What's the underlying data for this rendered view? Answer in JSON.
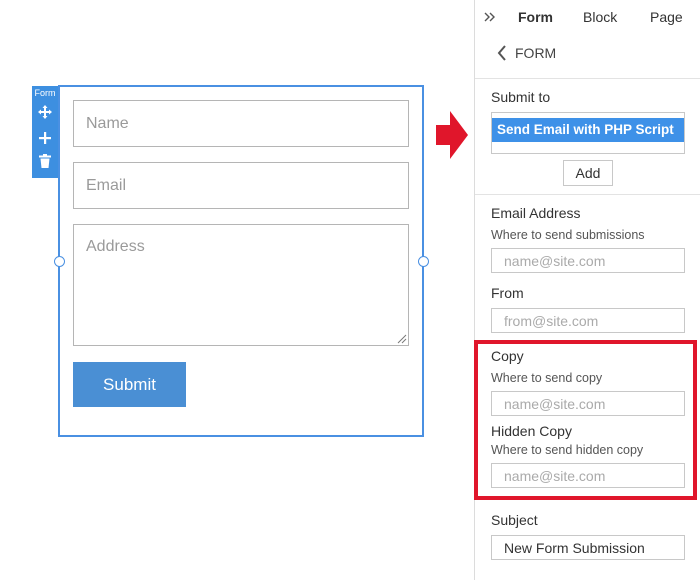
{
  "toolbar": {
    "label": "Form",
    "move_icon": "move-icon",
    "add_icon": "plus-icon",
    "delete_icon": "trash-icon"
  },
  "form": {
    "name_placeholder": "Name",
    "email_placeholder": "Email",
    "address_placeholder": "Address",
    "submit_label": "Submit"
  },
  "panel": {
    "tabs": [
      {
        "label": "Form",
        "active": true
      },
      {
        "label": "Block",
        "active": false
      },
      {
        "label": "Page",
        "active": false
      }
    ],
    "back_label": "FORM",
    "submit_to": {
      "label": "Submit to",
      "selected": "Send Email with PHP Script",
      "add_label": "Add"
    },
    "email_address": {
      "label": "Email Address",
      "hint": "Where to send submissions",
      "placeholder": "name@site.com"
    },
    "from": {
      "label": "From",
      "placeholder": "from@site.com"
    },
    "copy": {
      "label": "Copy",
      "hint": "Where to send copy",
      "placeholder": "name@site.com"
    },
    "hidden_copy": {
      "label": "Hidden Copy",
      "hint": "Where to send hidden copy",
      "placeholder": "name@site.com"
    },
    "subject": {
      "label": "Subject",
      "value": "New Form Submission"
    }
  },
  "colors": {
    "accent": "#4a90e2",
    "submit_button": "#4a8fd4",
    "highlight": "#e0162b",
    "selection": "#3e91e8"
  }
}
